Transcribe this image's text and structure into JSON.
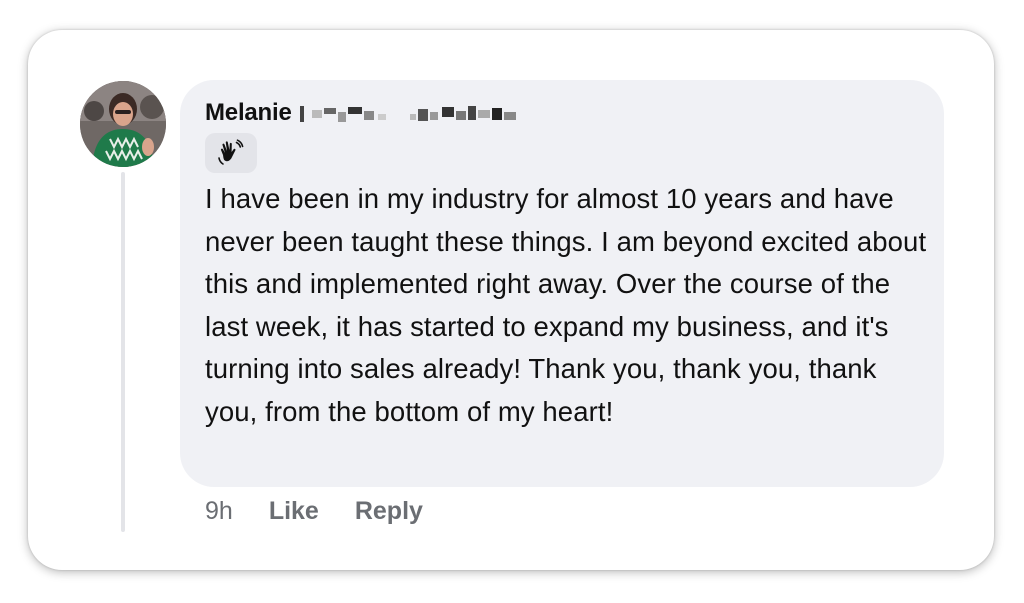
{
  "comment": {
    "author_name": "Melanie",
    "author_avatar": "user-avatar",
    "badge_icon": "waving-hand-icon",
    "text": "I have been in my industry for almost 10 years and have never been taught these things. I am beyond excited about this and implemented right away. Over the course of the last week, it has started to expand my business, and it's turning into sales already! Thank you, thank you, thank you, from the bottom of my heart!",
    "timestamp": "9h",
    "like_label": "Like",
    "reply_label": "Reply"
  },
  "colors": {
    "bubble_background": "#f0f1f5",
    "text": "#111111",
    "meta_text": "#6b6e73",
    "thread_line": "#e3e4e8"
  }
}
